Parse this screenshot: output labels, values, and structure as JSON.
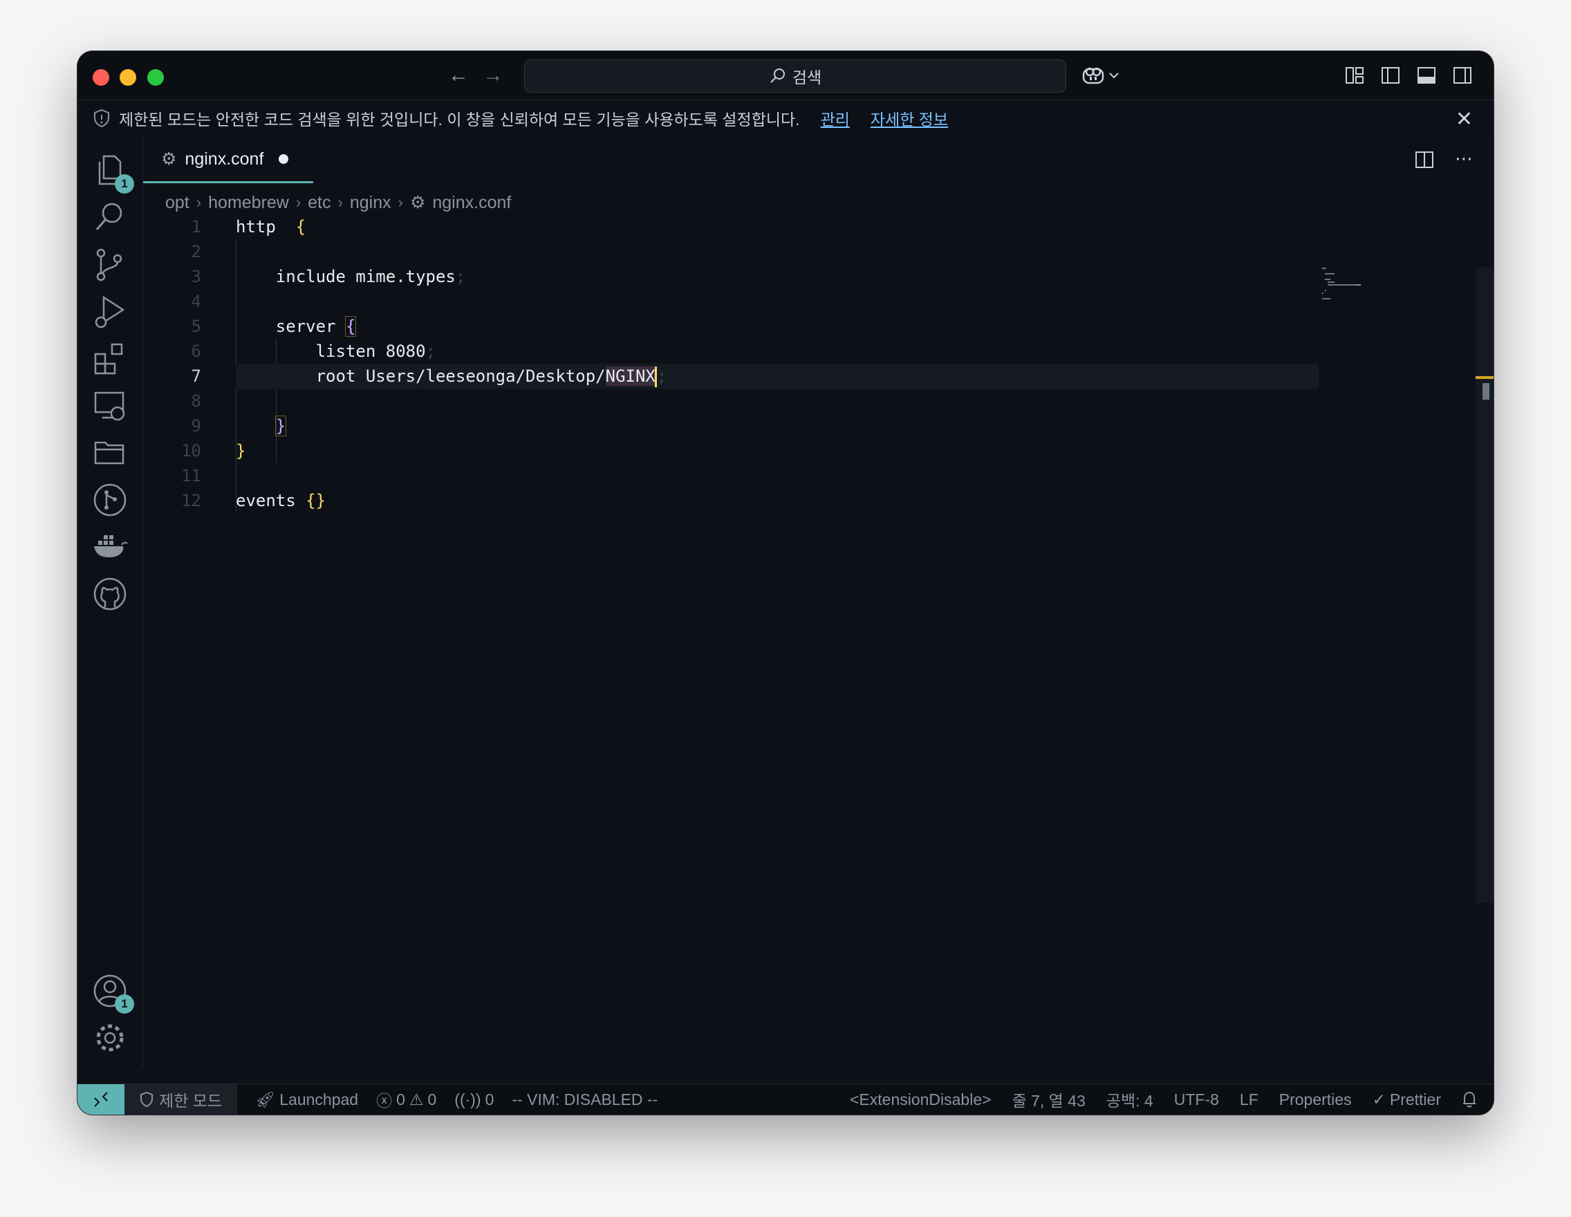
{
  "titlebar": {
    "search_placeholder": "검색"
  },
  "banner": {
    "message": "제한된 모드는 안전한 코드 검색을 위한 것입니다. 이 창을 신뢰하여 모든 기능을 사용하도록 설정합니다.",
    "manage_link": "관리",
    "learn_more_link": "자세한 정보"
  },
  "activity_bar": {
    "explorer_badge": "1",
    "accounts_badge": "1"
  },
  "tab": {
    "filename": "nginx.conf"
  },
  "breadcrumb": {
    "items": [
      "opt",
      "homebrew",
      "etc",
      "nginx",
      "nginx.conf"
    ]
  },
  "editor": {
    "line_numbers": [
      "1",
      "2",
      "3",
      "4",
      "5",
      "6",
      "7",
      "8",
      "9",
      "10",
      "11",
      "12"
    ],
    "active_line": 7,
    "lines": {
      "l1_keyword": "http",
      "l1_brace": "{",
      "l3_text": "include mime.types",
      "l5_text": "server ",
      "l5_brace": "{",
      "l6_text": "listen 8080",
      "l7_text": "root Users/leeseonga/Desktop/",
      "l7_selected": "NGINX",
      "l9_brace": "}",
      "l10_brace": "}",
      "l12_text": "events ",
      "l12_brace": "{}"
    },
    "semicolon": ";"
  },
  "statusbar": {
    "restricted_mode": "제한 모드",
    "launchpad": "Launchpad",
    "errors": "0",
    "warnings": "0",
    "ports": "0",
    "vim": "-- VIM: DISABLED --",
    "extension": "<ExtensionDisable>",
    "position": "줄 7, 열 43",
    "spaces": "공백: 4",
    "encoding": "UTF-8",
    "eol": "LF",
    "language": "Properties",
    "formatter": "Prettier"
  },
  "colors": {
    "accent": "#5fb3b3",
    "background": "#0d1117",
    "bracket_yellow": "#ffd866",
    "bracket_purple": "#d2a8ff"
  }
}
